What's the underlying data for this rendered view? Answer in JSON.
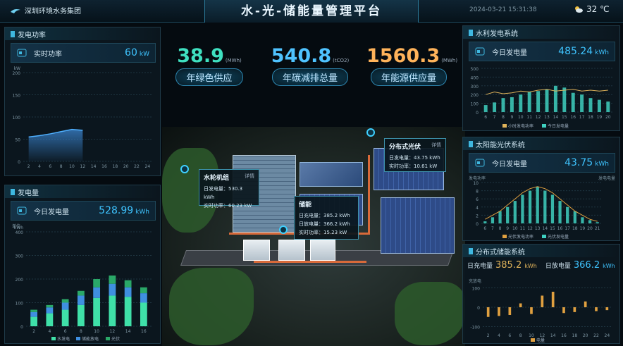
{
  "header": {
    "org": "深圳环境水务集团",
    "title": "水-光-储能量管理平台",
    "datetime": "2024-03-21  15:31:38",
    "weather_icon": "cloud-sun-icon",
    "temperature": "32 ℃"
  },
  "kpis": [
    {
      "value": "38.9",
      "unit": "(MWh)",
      "label": "年绿色供应",
      "color": "#3fe0c0"
    },
    {
      "value": "540.8",
      "unit": "(tCO2)",
      "label": "年碳减排总量",
      "color": "#4fc3ff"
    },
    {
      "value": "1560.3",
      "unit": "(MWh)",
      "label": "年能源供应量",
      "color": "#ffb35a"
    }
  ],
  "panel_water_power": {
    "title": "发电功率",
    "stat_label": "实时功率",
    "stat_value": "60",
    "stat_unit": "kW",
    "y_unit": "kW",
    "chart_data": {
      "type": "area",
      "x": [
        "2",
        "4",
        "6",
        "8",
        "10",
        "12",
        "14",
        "16",
        "18",
        "20",
        "22",
        "24"
      ],
      "yticks": [
        "0",
        "50",
        "100",
        "150",
        "200"
      ],
      "values": [
        55,
        58,
        62,
        67,
        72,
        70,
        null,
        null,
        null,
        null,
        null,
        null
      ],
      "ylim": [
        0,
        200
      ]
    }
  },
  "panel_generation": {
    "title": "发电量",
    "stat_label": "今日发电量",
    "stat_value": "528.99",
    "stat_unit": "kWh",
    "y_unit": "kWh",
    "y_label_left": "单位",
    "chart_data": {
      "type": "bar",
      "categories": [
        "2",
        "4",
        "6",
        "8",
        "10",
        "12",
        "14",
        "16"
      ],
      "yticks": [
        "0",
        "100",
        "200",
        "300",
        "400"
      ],
      "ylim": [
        0,
        400
      ],
      "series": [
        {
          "name": "水发电",
          "color": "#3fe0a8",
          "values": [
            40,
            55,
            70,
            90,
            120,
            130,
            125,
            100
          ]
        },
        {
          "name": "储能放电",
          "color": "#3f8fe0",
          "values": [
            20,
            25,
            30,
            40,
            45,
            50,
            40,
            40
          ]
        },
        {
          "name": "光伏",
          "color": "#2aa868",
          "values": [
            10,
            10,
            15,
            20,
            35,
            35,
            30,
            25
          ]
        }
      ],
      "legend": [
        "水发电",
        "储能放电",
        "光伏"
      ]
    }
  },
  "panel_hydro": {
    "title": "水利发电系统",
    "stat_label": "今日发电量",
    "stat_value": "485.24",
    "stat_unit": "kWh",
    "chart_data": {
      "type": "bar",
      "categories": [
        "6",
        "7",
        "8",
        "9",
        "10",
        "11",
        "12",
        "13",
        "14",
        "15",
        "16",
        "17",
        "18",
        "19",
        "20"
      ],
      "yticks": [
        "0",
        "100",
        "200",
        "300",
        "400",
        "500"
      ],
      "ylim": [
        0,
        500
      ],
      "series": [
        {
          "name": "小时发电功率",
          "color": "#e0b35a",
          "values": [
            200,
            230,
            210,
            220,
            240,
            230,
            250,
            260,
            240,
            250,
            260,
            240,
            250,
            240,
            250
          ]
        },
        {
          "name": "今日发电量",
          "color": "#3fd0c0",
          "values": [
            80,
            110,
            160,
            170,
            200,
            230,
            240,
            260,
            300,
            280,
            220,
            200,
            160,
            140,
            120
          ]
        }
      ],
      "legend": [
        "小时发电功率",
        "今日发电量"
      ]
    }
  },
  "panel_solar": {
    "title": "太阳能光伏系统",
    "stat_label": "今日发电量",
    "stat_value": "43.75",
    "stat_unit": "kWh",
    "y_label_left": "发电功率",
    "y_label_right": "发电电量",
    "chart_data": {
      "type": "bar",
      "categories": [
        "6",
        "7",
        "8",
        "9",
        "10",
        "11",
        "12",
        "13",
        "14",
        "15",
        "16",
        "17",
        "18",
        "19",
        "20",
        "21"
      ],
      "yticks": [
        "0",
        "2",
        "4",
        "6",
        "8",
        "10"
      ],
      "ylim": [
        0,
        10
      ],
      "series": [
        {
          "name": "光伏发电功率",
          "color": "#e0a040",
          "values": [
            1,
            2,
            3,
            4.5,
            6,
            7.5,
            8.5,
            9,
            8.5,
            7.5,
            6,
            4.5,
            3,
            2,
            1,
            0.5
          ]
        },
        {
          "name": "光伏发电量",
          "color": "#3fd0c0",
          "values": [
            0.5,
            1.5,
            3,
            4,
            5.5,
            7,
            8,
            9,
            8,
            7,
            5.5,
            4,
            3,
            1.5,
            0.8,
            0.3
          ]
        }
      ],
      "legend": [
        "光伏发电功率",
        "光伏发电量"
      ]
    }
  },
  "panel_storage": {
    "title": "分布式储能系统",
    "charge_label": "日充电量",
    "charge_value": "385.2",
    "charge_unit": "kWh",
    "discharge_label": "日放电量",
    "discharge_value": "366.2",
    "discharge_unit": "kWh",
    "y_label": "充放电",
    "chart_data": {
      "type": "bar",
      "categories": [
        "2",
        "4",
        "6",
        "8",
        "10",
        "12",
        "14",
        "16",
        "18",
        "20",
        "22",
        "24"
      ],
      "yticks": [
        "-100",
        "0",
        "100"
      ],
      "ylim": [
        -120,
        120
      ],
      "series": [
        {
          "name": "电量",
          "color": "#e0a040",
          "values": [
            -50,
            -45,
            -40,
            20,
            -35,
            60,
            80,
            -30,
            -25,
            30,
            -20,
            -15
          ]
        }
      ],
      "legend": [
        "电量"
      ]
    }
  },
  "popups": {
    "hydro": {
      "title": "水轮机组",
      "tag": "详情",
      "r1_label": "日发电量：",
      "r1_value": "530.3 kWh",
      "r2_label": "实时功率：",
      "r2_value": "60.23 kW"
    },
    "storage": {
      "title": "储能",
      "r1_label": "日充电量：",
      "r1_value": "385.2 kWh",
      "r2_label": "日放电量：",
      "r2_value": "366.2 kWh",
      "r3_label": "实时功率：",
      "r3_value": "15.23 kW"
    },
    "solar": {
      "title": "分布式光伏",
      "tag": "详情",
      "r1_label": "日发电量：",
      "r1_value": "43.75 kWh",
      "r2_label": "实时功率：",
      "r2_value": "10.61 kW"
    }
  }
}
